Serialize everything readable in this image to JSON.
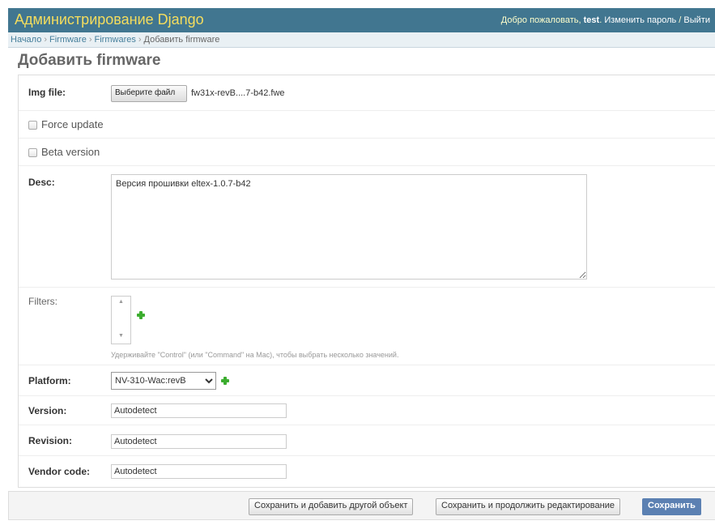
{
  "header": {
    "site_title": "Администрирование Django",
    "welcome": "Добро пожаловать,",
    "username": "test",
    "change_password": "Изменить пароль",
    "separator": "/",
    "logout": "Выйти"
  },
  "breadcrumbs": {
    "items": [
      "Начало",
      "Firmware",
      "Firmwares"
    ],
    "current": "Добавить firmware",
    "separator": "›"
  },
  "page_title": "Добавить firmware",
  "form": {
    "img_file": {
      "label": "Img file:",
      "button": "Выберите файл",
      "filename": "fw31x-revB....7-b42.fwe"
    },
    "force_update": {
      "label": "Force update",
      "checked": false
    },
    "beta_version": {
      "label": "Beta version",
      "checked": false
    },
    "desc": {
      "label": "Desc:",
      "value": "Версия прошивки eltex-1.0.7-b42"
    },
    "filters": {
      "label": "Filters:",
      "help": "Удерживайте \"Control\" (или \"Command\" на Mac), чтобы выбрать несколько значений."
    },
    "platform": {
      "label": "Platform:",
      "selected": "NV-310-Wac:revB"
    },
    "version": {
      "label": "Version:",
      "value": "Autodetect"
    },
    "revision": {
      "label": "Revision:",
      "value": "Autodetect"
    },
    "vendor_code": {
      "label": "Vendor code:",
      "value": "Autodetect"
    }
  },
  "submit": {
    "save_add_another": "Сохранить и добавить другой объект",
    "save_continue": "Сохранить и продолжить редактирование",
    "save": "Сохранить"
  },
  "colors": {
    "header_bg": "#417690",
    "site_title": "#f5dd5d",
    "breadcrumb_bg": "#e9f0f4",
    "link": "#447e9b",
    "default_button": "#5b80b2",
    "add_icon": "#3cad2f"
  }
}
